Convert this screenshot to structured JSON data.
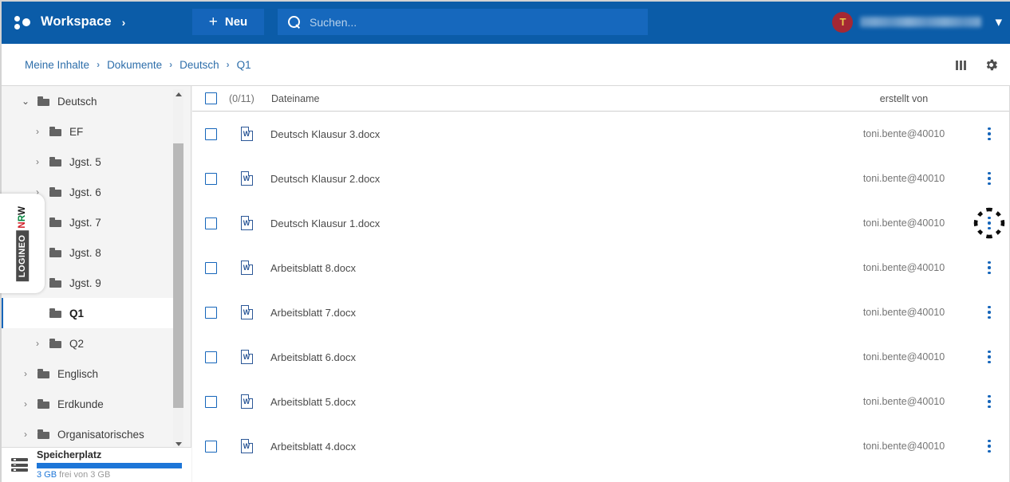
{
  "header": {
    "workspace_label": "Workspace",
    "workspace_chevron": "›",
    "new_button_plus": "+",
    "new_button_label": "Neu",
    "search_placeholder": "Suchen...",
    "search_value": "",
    "avatar_initial": "T",
    "user_chevron": "⌄"
  },
  "breadcrumb": {
    "items": [
      {
        "label": "Meine Inhalte"
      },
      {
        "label": "Dokumente"
      },
      {
        "label": "Deutsch"
      },
      {
        "label": "Q1"
      }
    ],
    "separator": "›"
  },
  "sidebar": {
    "tree": [
      {
        "label": "Deutsch",
        "indent": 26,
        "chevron": "⌄",
        "expanded": true,
        "selected": false
      },
      {
        "label": "EF",
        "indent": 41,
        "chevron": "›",
        "expanded": false,
        "selected": false
      },
      {
        "label": "Jgst. 5",
        "indent": 41,
        "chevron": "›",
        "expanded": false,
        "selected": false
      },
      {
        "label": "Jgst. 6",
        "indent": 41,
        "chevron": "›",
        "expanded": false,
        "selected": false
      },
      {
        "label": "Jgst. 7",
        "indent": 41,
        "chevron": "›",
        "expanded": false,
        "selected": false
      },
      {
        "label": "Jgst. 8",
        "indent": 41,
        "chevron": "›",
        "expanded": false,
        "selected": false
      },
      {
        "label": "Jgst. 9",
        "indent": 41,
        "chevron": "›",
        "expanded": false,
        "selected": false
      },
      {
        "label": "Q1",
        "indent": 41,
        "chevron": "",
        "expanded": false,
        "selected": true
      },
      {
        "label": "Q2",
        "indent": 41,
        "chevron": "›",
        "expanded": false,
        "selected": false
      },
      {
        "label": "Englisch",
        "indent": 26,
        "chevron": "›",
        "expanded": false,
        "selected": false
      },
      {
        "label": "Erdkunde",
        "indent": 26,
        "chevron": "›",
        "expanded": false,
        "selected": false
      },
      {
        "label": "Organisatorisches",
        "indent": 26,
        "chevron": "›",
        "expanded": false,
        "selected": false
      }
    ],
    "storage": {
      "title": "Speicherplatz",
      "free_value": "3 GB",
      "free_rest": " frei von 3 GB",
      "percent": 100
    },
    "side_tab": {
      "name": "LOGINEO",
      "n": "N",
      "r": "R",
      "w": "W"
    }
  },
  "toolbar": {
    "columns_icon": "columns-icon",
    "settings_icon": "gear-icon"
  },
  "file_list": {
    "columns": {
      "selection_count": "(0/11)",
      "filename": "Dateiname",
      "created_by": "erstellt von"
    },
    "rows": [
      {
        "name": "Deutsch Klausur 3.docx",
        "owner": "toni.bente@40010",
        "type": "W",
        "highlighted": false
      },
      {
        "name": "Deutsch Klausur 2.docx",
        "owner": "toni.bente@40010",
        "type": "W",
        "highlighted": false
      },
      {
        "name": "Deutsch Klausur 1.docx",
        "owner": "toni.bente@40010",
        "type": "W",
        "highlighted": true
      },
      {
        "name": "Arbeitsblatt 8.docx",
        "owner": "toni.bente@40010",
        "type": "W",
        "highlighted": false
      },
      {
        "name": "Arbeitsblatt 7.docx",
        "owner": "toni.bente@40010",
        "type": "W",
        "highlighted": false
      },
      {
        "name": "Arbeitsblatt 6.docx",
        "owner": "toni.bente@40010",
        "type": "W",
        "highlighted": false
      },
      {
        "name": "Arbeitsblatt 5.docx",
        "owner": "toni.bente@40010",
        "type": "W",
        "highlighted": false
      },
      {
        "name": "Arbeitsblatt 4.docx",
        "owner": "toni.bente@40010",
        "type": "W",
        "highlighted": false
      }
    ]
  },
  "colors": {
    "header_blue": "#0b5ca8",
    "accent_blue": "#1565ba",
    "storage_blue": "#1d76d8",
    "avatar_red": "#a42834",
    "nrw_red": "#cf1d26",
    "nrw_green": "#00843d"
  }
}
